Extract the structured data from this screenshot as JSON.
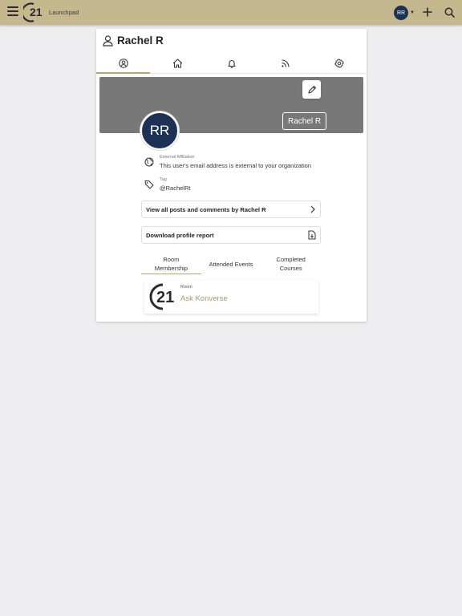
{
  "header": {
    "app_name": "Launchpad",
    "user_initials": "RR"
  },
  "profile": {
    "title": "Rachel R",
    "avatar_initials": "RR",
    "banner_name": "Rachel R",
    "tabs": [
      "user-icon",
      "home-icon",
      "bell-icon",
      "feed-icon",
      "gear-icon"
    ],
    "affiliation_label": "External Affiliation",
    "affiliation_value": "This user's email address is external to your organization",
    "tag_label": "Tag",
    "tag_value": "@RachelRt",
    "view_posts_label": "View all posts and comments by Rachel R",
    "download_label": "Download profile report"
  },
  "subtabs": {
    "room": "Room\nMembership",
    "events": "Attended Events",
    "courses": "Completed\nCourses"
  },
  "room": {
    "label": "Room",
    "name": "Ask Konverse",
    "logo_text": "21"
  },
  "colors": {
    "topbar": "#c5b78e",
    "accent": "#b6a570",
    "avatar": "#1d3155",
    "banner": "#787878",
    "room_name": "#a89a6a"
  }
}
